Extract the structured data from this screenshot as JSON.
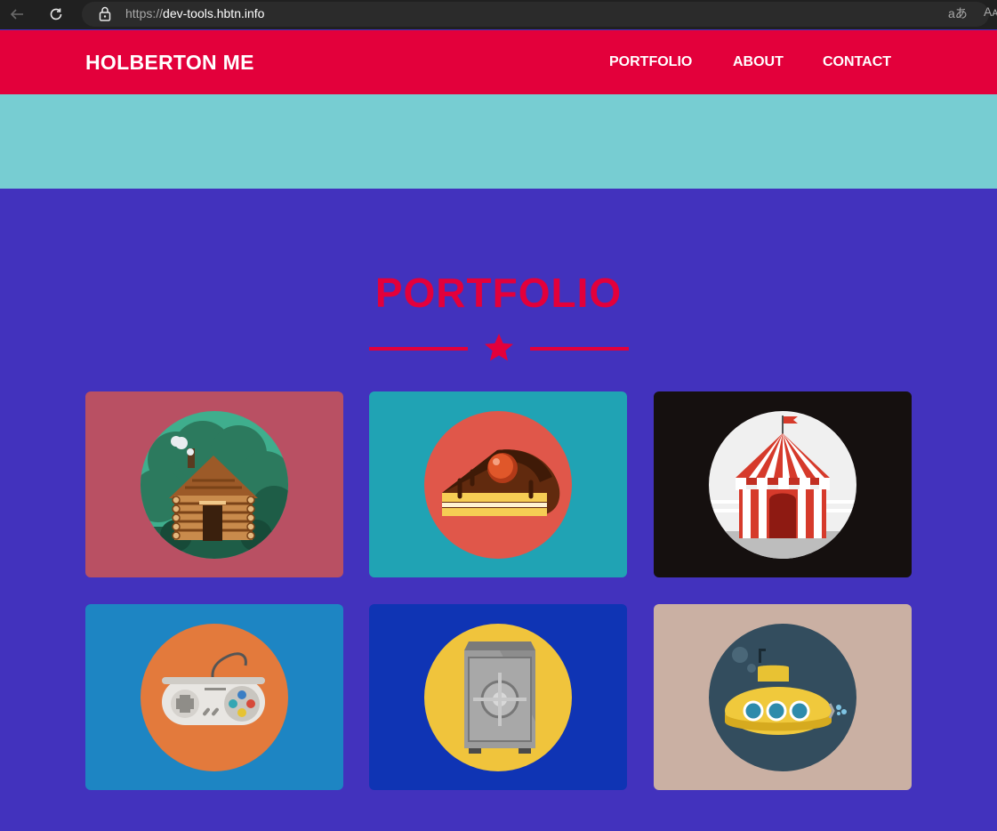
{
  "browser": {
    "url_scheme": "https://",
    "url_host": "dev-tools.hbtn.info",
    "icons": [
      "back-arrow-icon",
      "reload-icon",
      "lock-icon",
      "translate-icon",
      "read-aloud-icon"
    ],
    "translate_label": "aあ",
    "read_label": "Aᴀ"
  },
  "header": {
    "logo": "HOLBERTON ME",
    "nav": [
      "PORTFOLIO",
      "ABOUT",
      "CONTACT"
    ],
    "background": "#e3003b"
  },
  "hero": {
    "background": "#77cdd2"
  },
  "portfolio": {
    "title": "PORTFOLIO",
    "background": "#4232bd",
    "accent": "#e3003b",
    "divider_icon": "star-icon",
    "items": [
      {
        "icon": "cabin-icon",
        "background": "#b95063"
      },
      {
        "icon": "cake-icon",
        "background": "#20a3b4"
      },
      {
        "icon": "circus-tent-icon",
        "background": "#15100f"
      },
      {
        "icon": "game-controller-icon",
        "background": "#1d85c3"
      },
      {
        "icon": "safe-icon",
        "background": "#0f34b4"
      },
      {
        "icon": "submarine-icon",
        "background": "#cab0a3"
      }
    ]
  }
}
